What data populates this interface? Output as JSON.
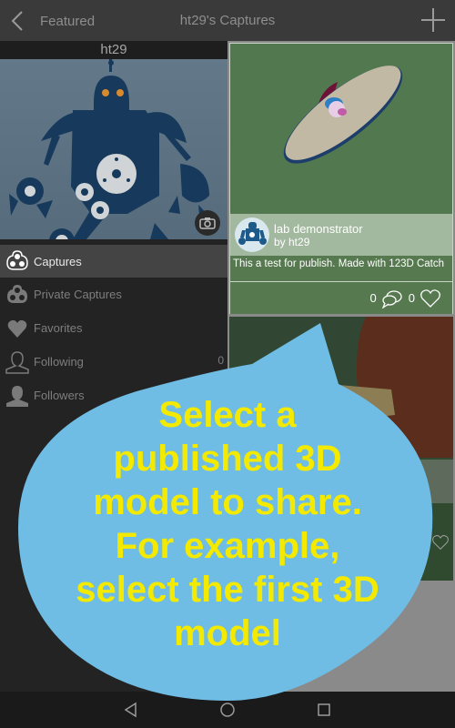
{
  "topbar": {
    "back_label": "Featured",
    "title": "ht29's Captures",
    "add_icon": "plus-icon",
    "back_icon": "chevron-left-icon"
  },
  "profile": {
    "username": "ht29",
    "camera_icon": "camera-icon"
  },
  "menu": {
    "items": [
      {
        "label": "Captures",
        "icon": "captures-icon",
        "active": true
      },
      {
        "label": "Private Captures",
        "icon": "private-captures-icon",
        "active": false
      },
      {
        "label": "Favorites",
        "icon": "heart-icon",
        "active": false
      },
      {
        "label": "Following",
        "icon": "person-outline-icon",
        "active": false,
        "count": "0"
      },
      {
        "label": "Followers",
        "icon": "person-icon",
        "active": false
      }
    ]
  },
  "cards": [
    {
      "title": "lab demonstrator",
      "author": "by ht29",
      "description": "This a test for publish. Made with 123D Catch",
      "comments": "0",
      "likes": "0"
    }
  ],
  "overlay": {
    "lines": [
      "Select a",
      "published 3D",
      "model to share.",
      "For example,",
      "select the first 3D",
      "model"
    ],
    "bubble_color": "#6fbde4",
    "text_color": "#f4ea00"
  },
  "navbar": {
    "back": "nav-back-icon",
    "home": "nav-home-icon",
    "recents": "nav-recents-icon"
  }
}
